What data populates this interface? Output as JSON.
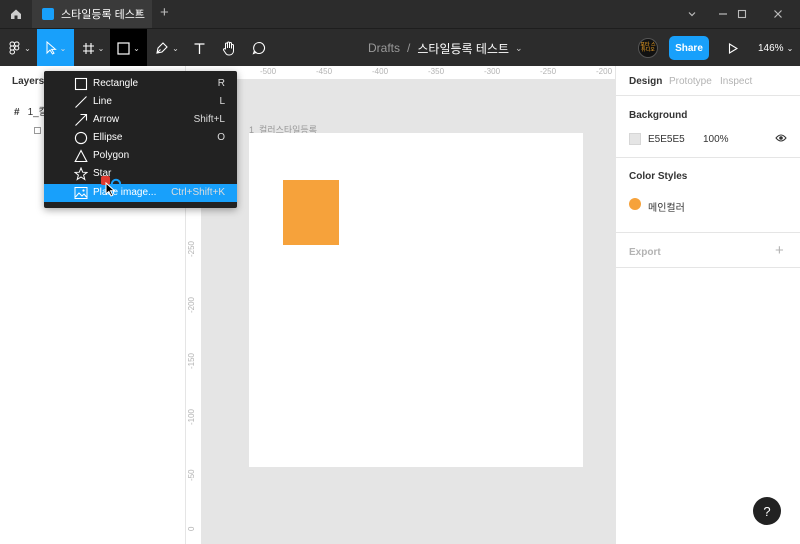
{
  "app": {
    "tab_title": "스타일등록 테스트",
    "tab_close": "✕",
    "new_tab": "+"
  },
  "toolbar": {
    "breadcrumb_folder": "Drafts",
    "breadcrumb_sep": "/",
    "file_name": "스타일등록 테스트",
    "avatar_text": "포타 스튜디오",
    "share_label": "Share",
    "zoom_label": "146%"
  },
  "layers": {
    "title": "Layers",
    "frame_row": "1_칼"
  },
  "rulers": {
    "top": [
      "-500",
      "-450",
      "-400",
      "-350",
      "-300",
      "-250",
      "-200"
    ],
    "left": [
      "-250",
      "-200",
      "-150",
      "-100",
      "-50",
      "0"
    ]
  },
  "canvas": {
    "frame_label": "1_컬러스타일등록"
  },
  "menu": {
    "items": [
      {
        "label": "Rectangle",
        "shortcut": "R",
        "icon": "rectangle-icon"
      },
      {
        "label": "Line",
        "shortcut": "L",
        "icon": "line-icon"
      },
      {
        "label": "Arrow",
        "shortcut": "Shift+L",
        "icon": "arrow-icon"
      },
      {
        "label": "Ellipse",
        "shortcut": "O",
        "icon": "ellipse-icon"
      },
      {
        "label": "Polygon",
        "shortcut": "",
        "icon": "polygon-icon"
      },
      {
        "label": "Star",
        "shortcut": "",
        "icon": "star-icon"
      },
      {
        "label": "Place image...",
        "shortcut": "Ctrl+Shift+K",
        "icon": "image-icon"
      }
    ],
    "highlighted_index": 6
  },
  "right_panel": {
    "tabs": [
      "Design",
      "Prototype",
      "Inspect"
    ],
    "background_title": "Background",
    "background_hex": "E5E5E5",
    "background_opacity": "100%",
    "color_styles_title": "Color Styles",
    "color_style_name": "메인컬러",
    "export_title": "Export",
    "export_add": "+"
  },
  "help": "?",
  "colors": {
    "accent": "#18a0fb",
    "orange": "#f6a23b",
    "dark_ui": "#2c2c2c",
    "canvas_bg": "#e5e5e5"
  }
}
